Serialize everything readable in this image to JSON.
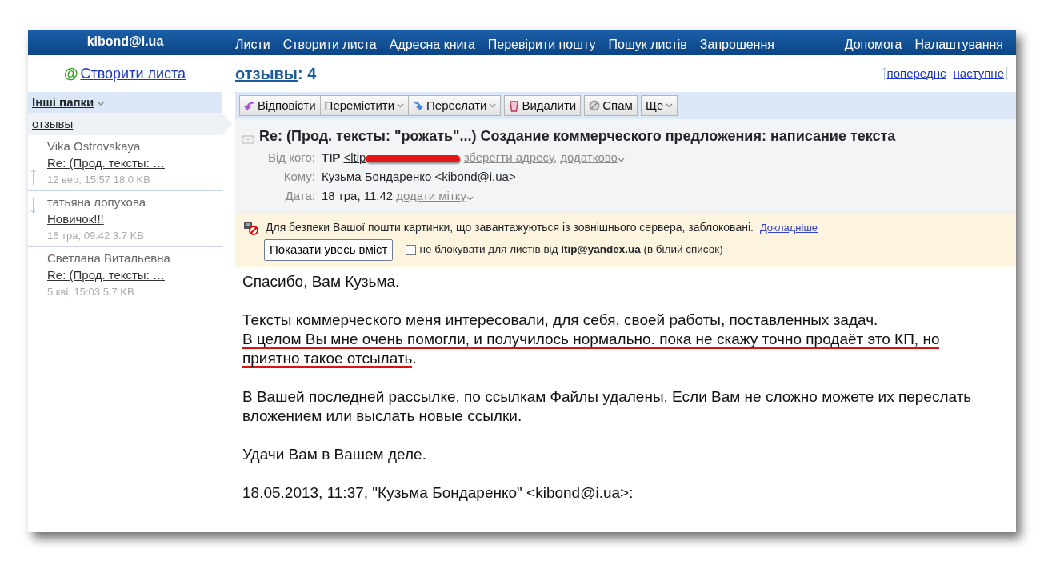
{
  "account": "kibond@i.ua",
  "top_nav": [
    {
      "label": "Листи"
    },
    {
      "label": "Створити листа"
    },
    {
      "label": "Адресна книга"
    },
    {
      "label": "Перевірити пошту"
    },
    {
      "label": "Пошук листів"
    },
    {
      "label": "Запрошення"
    }
  ],
  "help_nav": [
    {
      "label": "Допомога"
    },
    {
      "label": "Налаштування"
    }
  ],
  "compose_icon": "@",
  "compose_link": "Створити листа",
  "folders_header": "Інші папки",
  "folders": [
    {
      "label": "отзывы",
      "selected": true
    }
  ],
  "messages": [
    {
      "sender": "Vika Ostrovskaya",
      "subject": "Re: (Прод. тексты: …",
      "meta": "12 вер, 15:57 18.0 KB",
      "kind": "previous"
    },
    {
      "sender": "татьяна лопухова",
      "subject": "Новичок!!!",
      "meta": "16 тра, 09:42 3.7 KB",
      "kind": "next"
    },
    {
      "sender": "Светлана Витальевна",
      "subject": "Re: (Прод. тексты: …",
      "meta": "5 кві, 15:03 5.7 KB",
      "kind": "plain"
    }
  ],
  "folder_title": "отзывы",
  "count_label": ": 4",
  "pager": [
    {
      "label": "попереднє",
      "kind": "previous"
    },
    {
      "label": "наступне",
      "kind": "next"
    }
  ],
  "toolbar": [
    [
      {
        "label": "Відповісти",
        "kind": "reply",
        "dropdown": false
      },
      {
        "label": "Перемістити",
        "kind": "move",
        "dropdown": true
      },
      {
        "label": "Переслати",
        "kind": "forward",
        "dropdown": true
      }
    ],
    [
      {
        "label": "Видалити",
        "kind": "delete",
        "dropdown": false
      }
    ],
    [
      {
        "label": "Спам",
        "kind": "spam",
        "dropdown": false
      }
    ],
    [
      {
        "label": "Ще",
        "kind": "more",
        "dropdown": true
      }
    ]
  ],
  "message": {
    "subject": "Re: (Прод. тексты: \"рожать\"...) Создание коммерческого предложения: написание текста",
    "fields": [
      {
        "kind": "from",
        "label": "Від кого:",
        "name": "TIP",
        "address": "<ltip",
        "redacted": true,
        "links": [
          {
            "label": "зберегти адресу",
            "dropdown": false
          },
          {
            "label": "додатково",
            "dropdown": true
          }
        ],
        "separator": ","
      },
      {
        "kind": "plain",
        "label": "Кому:",
        "value": "Кузьма Бондаренко <kibond@i.ua>"
      },
      {
        "kind": "date",
        "label": "Дата:",
        "value": "18 тра, 11:42",
        "links": [
          {
            "label": "додати мітку",
            "dropdown": true
          }
        ]
      }
    ]
  },
  "warning": {
    "text": "Для безпеки Вашої пошти картинки, що завантажуються із зовнішнього сервера, заблоковані.",
    "link": "Докладніше",
    "button": "Показати увесь вміст",
    "checkbox": {
      "checked": false,
      "text": "не блокувати для листів від **ltip@yandex.ua** (в білий список)"
    }
  },
  "body": [
    {
      "lines": [
        [
          {
            "text": "Спасибо, Вам Кузьма.",
            "annotated": false
          }
        ]
      ]
    },
    {
      "lines": [
        [
          {
            "text": "Тексты коммерческого меня интересовали, для себя, своей работы, поставленных задач.",
            "annotated": false
          }
        ],
        [
          {
            "text": "В целом Вы мне очень помогли, и получилось нормально. пока не скажу точно продаёт это КП, но приятно такое отсылать",
            "annotated": true
          },
          {
            "text": ".",
            "annotated": false
          }
        ]
      ]
    },
    {
      "lines": [
        [
          {
            "text": "В Вашей последней рассылке, по ссылкам Файлы удалены, Если Вам не сложно можете их переслать вложением или выслать новые ссылки.",
            "annotated": false
          }
        ]
      ]
    },
    {
      "lines": [
        [
          {
            "text": "Удачи Вам в Вашем деле.",
            "annotated": false
          }
        ]
      ]
    },
    {
      "lines": [
        [
          {
            "text": "18.05.2013, 11:37, \"Кузьма Бондаренко\" <kibond@i.ua>:",
            "annotated": false
          }
        ]
      ]
    }
  ]
}
